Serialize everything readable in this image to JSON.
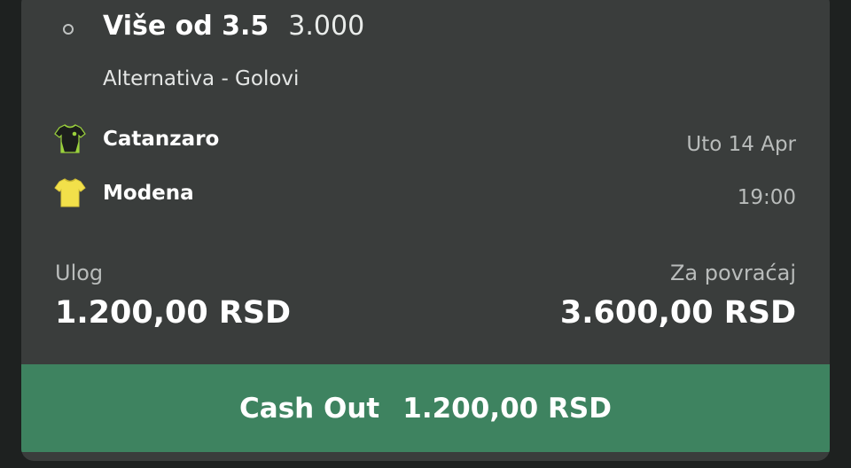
{
  "selection": {
    "name": "Više od 3.5",
    "odds": "3.000",
    "market": "Alternativa - Golovi"
  },
  "match": {
    "home_team": "Catanzaro",
    "away_team": "Modena",
    "date": "Uto 14 Apr",
    "time": "19:00",
    "home_shirt_icon": "black-green-shirt-icon",
    "away_shirt_icon": "yellow-shirt-icon"
  },
  "stake": {
    "label": "Ulog",
    "value": "1.200,00 RSD"
  },
  "returns": {
    "label": "Za povraćaj",
    "value": "3.600,00 RSD"
  },
  "cashout": {
    "label": "Cash Out",
    "amount": "1.200,00 RSD"
  },
  "colors": {
    "background": "#1e2120",
    "card": "#3a3d3c",
    "cashout_button": "#3e8360",
    "away_shirt": "#f2e04a",
    "home_shirt": "#1c1f1c",
    "home_shirt_accent": "#9bd23c"
  }
}
